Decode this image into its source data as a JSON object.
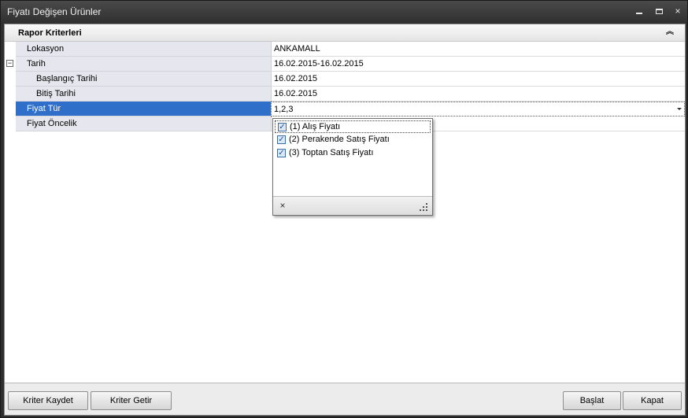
{
  "window": {
    "title": "Fiyatı Değişen Ürünler",
    "controls": {
      "minimize": "minimize-icon",
      "maximize": "maximize-icon",
      "close": "×"
    }
  },
  "group": {
    "title": "Rapor Kriterleri",
    "collapse_glyph": "︽"
  },
  "grid": {
    "rows": [
      {
        "label": "Lokasyon",
        "value": "ANKAMALL"
      },
      {
        "label": "Tarih",
        "value": "16.02.2015-16.02.2015",
        "expander": "−"
      },
      {
        "label": "Başlangıç Tarihi",
        "value": "16.02.2015"
      },
      {
        "label": "Bitiş Tarihi",
        "value": "16.02.2015"
      },
      {
        "label": "Fiyat Tür",
        "value": "1,2,3",
        "selected": true
      },
      {
        "label": "Fiyat Öncelik",
        "value": ""
      }
    ]
  },
  "popup": {
    "items": [
      {
        "label": "(1) Alış Fiyatı",
        "checked": true
      },
      {
        "label": "(2) Perakende Satış Fiyatı",
        "checked": true
      },
      {
        "label": "(3) Toptan Satış Fiyatı",
        "checked": true
      }
    ],
    "check_glyph": "✓",
    "close_glyph": "×"
  },
  "buttons": {
    "save": "Kriter Kaydet",
    "load": "Kriter Getir",
    "start": "Başlat",
    "close": "Kapat"
  }
}
